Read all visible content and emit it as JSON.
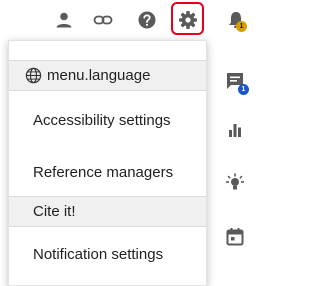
{
  "toolbar": {
    "icons": [
      "user-icon",
      "link-icon",
      "help-icon",
      "gear-icon",
      "bell-icon"
    ],
    "notifications_badge": "1",
    "highlighted_icon": "gear-icon",
    "highlight_color": "#e8001c",
    "icon_color": "#5a5a5a"
  },
  "side_rail": {
    "icons": [
      "chat-icon",
      "bar-chart-icon",
      "lightbulb-icon",
      "calendar-icon"
    ],
    "chat_badge": "1",
    "chat_badge_color": "#1b55c7",
    "bell_badge_color": "#d89e00"
  },
  "settings_menu": {
    "language_label": "menu.language",
    "items": [
      {
        "label": "Accessibility settings"
      },
      {
        "label": "Reference managers"
      }
    ],
    "cite_label": "Cite it!",
    "notification_label": "Notification settings"
  }
}
